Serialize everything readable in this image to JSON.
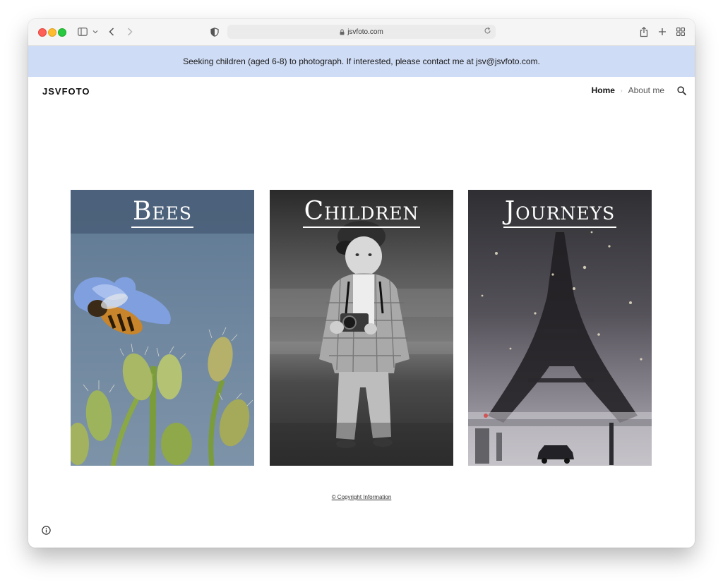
{
  "browser": {
    "url": "jsvfoto.com",
    "icons": [
      "sidebar-icon",
      "chevron-down-icon",
      "back-icon",
      "forward-icon",
      "shield-icon",
      "lock-icon",
      "reload-icon",
      "share-icon",
      "new-tab-icon",
      "tab-overview-icon"
    ]
  },
  "banner": {
    "text": "Seeking children (aged 6-8) to photograph. If interested, please contact me at jsv@jsvfoto.com."
  },
  "site": {
    "logo": "JSVFOTO",
    "nav": [
      {
        "label": "Home",
        "active": true
      },
      {
        "label": "About me",
        "active": false
      }
    ]
  },
  "gallery": [
    {
      "title": "Bees"
    },
    {
      "title": "Children"
    },
    {
      "title": "Journeys"
    }
  ],
  "footer": {
    "copyright": "© Copyright Information"
  },
  "colors": {
    "banner_bg": "#cfdcf5",
    "accent_text": "#111111"
  }
}
